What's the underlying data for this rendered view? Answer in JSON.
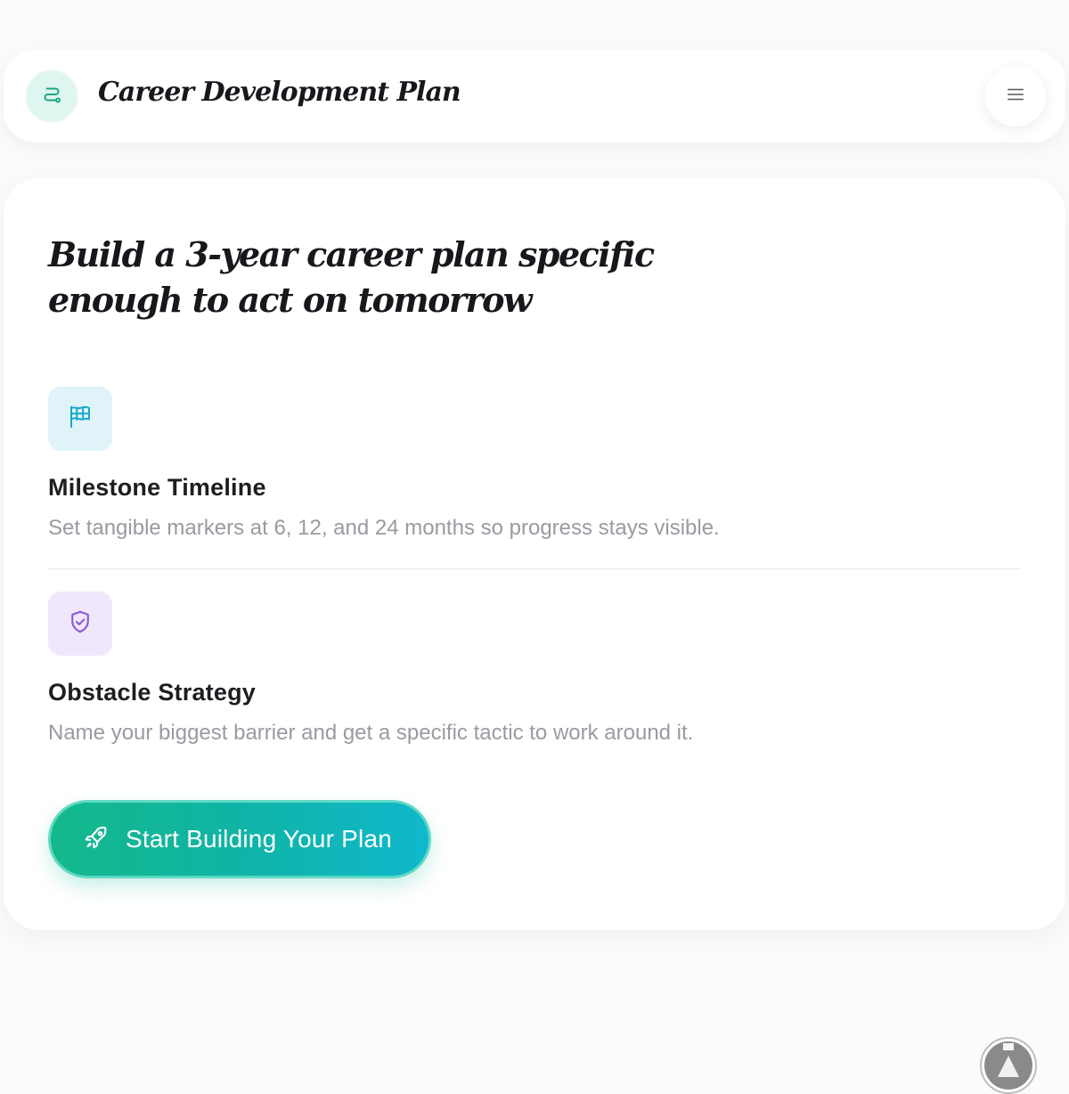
{
  "header": {
    "title": "Career Development Plan",
    "logo_icon": "route-icon",
    "menu_icon": "hamburger-menu-icon"
  },
  "main": {
    "headline_line1": "Build a 3-year career plan specific",
    "headline_line2": "enough to act on tomorrow",
    "features": [
      {
        "icon": "flag-icon",
        "icon_color": "#17a9c9",
        "title": "Milestone Timeline",
        "description": "Set tangible markers at 6, 12, and 24 months so progress stays visible."
      },
      {
        "icon": "shield-check-icon",
        "icon_color": "#8a5ad9",
        "title": "Obstacle Strategy",
        "description": "Name your biggest barrier and get a specific tactic to work around it."
      }
    ],
    "cta": {
      "label": "Start Building Your Plan",
      "icon": "rocket-icon"
    }
  },
  "colors": {
    "accent_green": "#14b88a",
    "accent_cyan": "#0fb8cc",
    "text_primary": "#17171c",
    "text_muted": "#9a9aa2"
  },
  "corner_widget": {
    "icon": "avatar-icon"
  }
}
